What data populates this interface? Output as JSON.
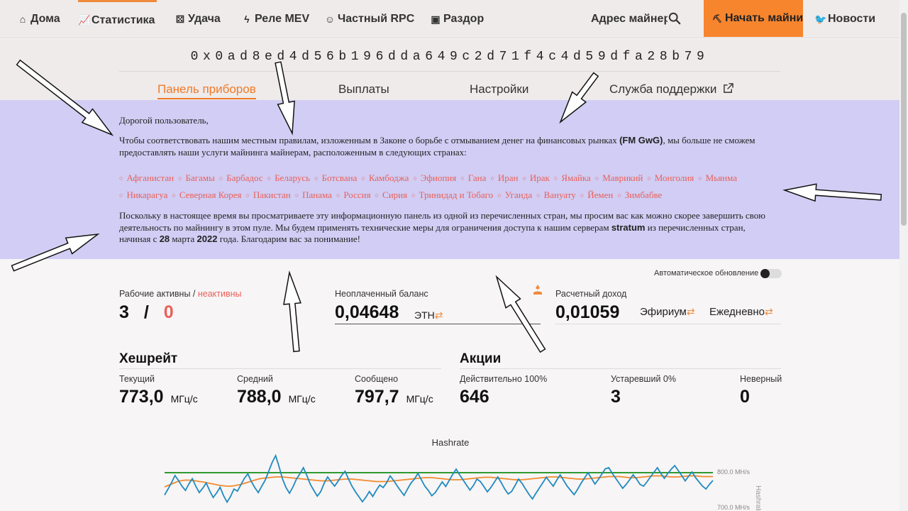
{
  "nav": {
    "home": "Дома",
    "stats": "Статистика",
    "luck": "Удача",
    "mev": "Реле MEV",
    "rpc": "Частный RPC",
    "discord": "Раздор",
    "miner_address": "Адрес майнера",
    "start_mining": "Начать майнинг",
    "news": "Новости"
  },
  "wallet_address": "0x0ad8ed4d56b196dda649c2d71f4c4d59dfa28b79",
  "tabs": {
    "dashboard": "Панель приборов",
    "payouts": "Выплаты",
    "settings": "Настройки",
    "support": "Служба поддержки"
  },
  "notice": {
    "greeting": "Дорогой пользователь,",
    "p1_a": "Чтобы соответствовать нашим местным правилам, изложенным в Законе о борьбе с отмыванием денег на финансовых рынках",
    "p1_bold": "(FM GwG)",
    "p1_b": ", мы больше не сможем предоставлять наши услуги майнинга майнерам, расположенным в следующих странах:",
    "countries": [
      "Афганистан",
      "Багамы",
      "Барбадос",
      "Беларусь",
      "Ботсвана",
      "Камбоджа",
      "Эфиопия",
      "Гана",
      "Иран",
      "Ирак",
      "Ямайка",
      "Маврикий",
      "Монголия",
      "Мьянма",
      "Никарагуа",
      "Северная Корея",
      "Пакистан",
      "Панама",
      "Россия",
      "Сирия",
      "Тринидад и Тобаго",
      "Уганда",
      "Вануату",
      "Йемен",
      "Зимбабве"
    ],
    "p2_a": "Поскольку в настоящее время вы просматриваете эту информационную панель из одной из перечисленных стран, мы просим вас как можно скорее завершить свою деятельность по майнингу в этом пуле. Мы будем применять технические меры для ограничения доступа к нашим серверам",
    "p2_bold1": "stratum",
    "p2_b": "из перечисленных стран, начиная с",
    "p2_bold2": "28",
    "p2_c": "марта",
    "p2_bold3": "2022",
    "p2_d": "года. Благодарим вас за понимание!"
  },
  "auto_update_label": "Автоматическое обновление",
  "workers": {
    "label_a": "Рабочие  активны /",
    "label_b": "неактивны",
    "active": "3",
    "slash": "/",
    "inactive": "0"
  },
  "balance": {
    "label": "Неоплаченный баланс",
    "value": "0,04648",
    "unit": "ЭТН"
  },
  "income": {
    "label": "Расчетный доход",
    "value": "0,01059",
    "unit1": "Эфириум",
    "unit2": "Ежедневно"
  },
  "hashrate": {
    "title": "Хешрейт",
    "current_label": "Текущий",
    "current": "773,0",
    "average_label": "Средний",
    "average": "788,0",
    "reported_label": "Сообщено",
    "reported": "797,7",
    "unit": "МГц/с"
  },
  "shares": {
    "title": "Акции",
    "valid_label": "Действительно 100%",
    "valid": "646",
    "stale_label": "Устаревший 0%",
    "stale": "3",
    "invalid_label": "Неверный",
    "invalid": "0"
  },
  "chart_data": {
    "type": "line",
    "title": "Hashrate",
    "y_tick_labels": [
      "800.0 MH/s",
      "700.0 MH/s"
    ],
    "ylabel": "Hashrate",
    "ylim": [
      690,
      850
    ],
    "series": [
      {
        "name": "current",
        "color": "#1f8ac0",
        "values": [
          735,
          752,
          770,
          790,
          776,
          760,
          748,
          766,
          781,
          760,
          742,
          754,
          769,
          747,
          728,
          741,
          757,
          733,
          715,
          731,
          752,
          746,
          764,
          782,
          795,
          773,
          756,
          742,
          760,
          777,
          802,
          827,
          846,
          815,
          780,
          756,
          740,
          758,
          780,
          795,
          812,
          790,
          765,
          748,
          732,
          745,
          769,
          786,
          772,
          760,
          774,
          790,
          802,
          780,
          760,
          744,
          730,
          716,
          729,
          745,
          731,
          748,
          763,
          756,
          770,
          789,
          776,
          761,
          747,
          734,
          752,
          769,
          780,
          796,
          778,
          760,
          748,
          733,
          742,
          757,
          772,
          759,
          776,
          793,
          808,
          792,
          778,
          763,
          749,
          762,
          780,
          773,
          759,
          744,
          756,
          771,
          786,
          770,
          752,
          738,
          745,
          762,
          780,
          768,
          752,
          737,
          724,
          740,
          755,
          770,
          785,
          772,
          760,
          777,
          792,
          776,
          760,
          748,
          736,
          751,
          768,
          783,
          798,
          782,
          766,
          779,
          794,
          809,
          812,
          796,
          782,
          768,
          754,
          765,
          778,
          792,
          780,
          765,
          760,
          772,
          786,
          799,
          812,
          796,
          782,
          796,
          808,
          818,
          804,
          790,
          775,
          788,
          800,
          784,
          772,
          760,
          752,
          765,
          776
        ]
      },
      {
        "name": "average",
        "color": "#f28a2e",
        "values": [
          758,
          762,
          766,
          770,
          774,
          776,
          777,
          777,
          776,
          775,
          773,
          772,
          770,
          768,
          766,
          764,
          762,
          761,
          760,
          760,
          761,
          763,
          765,
          768,
          771,
          774,
          777,
          780,
          782,
          783,
          784,
          785,
          786,
          786,
          786,
          785,
          784,
          783,
          782,
          781,
          780,
          779,
          778,
          777,
          776,
          775,
          775,
          775,
          776,
          777,
          778,
          779,
          780,
          780,
          780,
          779,
          778,
          777,
          776,
          775,
          774,
          773,
          773,
          773,
          773,
          774,
          775,
          776,
          777,
          778,
          779,
          780,
          781,
          782,
          783,
          784,
          784,
          784,
          783,
          782,
          781,
          780,
          779,
          778,
          778,
          778,
          779,
          780,
          781,
          782,
          783,
          784,
          785,
          785,
          785,
          784,
          783,
          782,
          781,
          780,
          779,
          778,
          778,
          778,
          779,
          780,
          781,
          782,
          783,
          784,
          785,
          786,
          786,
          786,
          785,
          784,
          783,
          782,
          781,
          780,
          780,
          780,
          781,
          782,
          783,
          784,
          785,
          786,
          787,
          787,
          787,
          787,
          786,
          785,
          784,
          784,
          784,
          785,
          786,
          787,
          788,
          789,
          789,
          789,
          788,
          787,
          786,
          786,
          786,
          787,
          788,
          789,
          789,
          789,
          788,
          787,
          787,
          787,
          787
        ]
      },
      {
        "name": "reported",
        "color": "#2f9a2f",
        "values": [
          798,
          798,
          798,
          798,
          798,
          798,
          798,
          798,
          798,
          798,
          798,
          798,
          798,
          798,
          798,
          798,
          798,
          798,
          798,
          798,
          798,
          798,
          798,
          798,
          798,
          798,
          798,
          798,
          798,
          798,
          798,
          798,
          798,
          798,
          798,
          798,
          798,
          798,
          798,
          798,
          798,
          798,
          798,
          798,
          798,
          798,
          798,
          798,
          798,
          798,
          798,
          798,
          798,
          798,
          798,
          798,
          798,
          798,
          798,
          798,
          798,
          798,
          798,
          798,
          798,
          798,
          798,
          798,
          798,
          798,
          798,
          798,
          798,
          798,
          798,
          798,
          798,
          798,
          798,
          798,
          798,
          798,
          798,
          798,
          798,
          798,
          798,
          798,
          798,
          798,
          798,
          798,
          798,
          798,
          798,
          798,
          798,
          798,
          798,
          798,
          798,
          798,
          798,
          798,
          798,
          798,
          798,
          798,
          798,
          798,
          798,
          798,
          798,
          798,
          798,
          798,
          798,
          798,
          798,
          798,
          798,
          798,
          798,
          798,
          798,
          798,
          798,
          798,
          798,
          798,
          798,
          798,
          798,
          798,
          798,
          798,
          798,
          798,
          798,
          798,
          798,
          798,
          798,
          798,
          798,
          798,
          798,
          798,
          798,
          798,
          798,
          798,
          798,
          798,
          798,
          798,
          798,
          798,
          798
        ]
      }
    ]
  }
}
